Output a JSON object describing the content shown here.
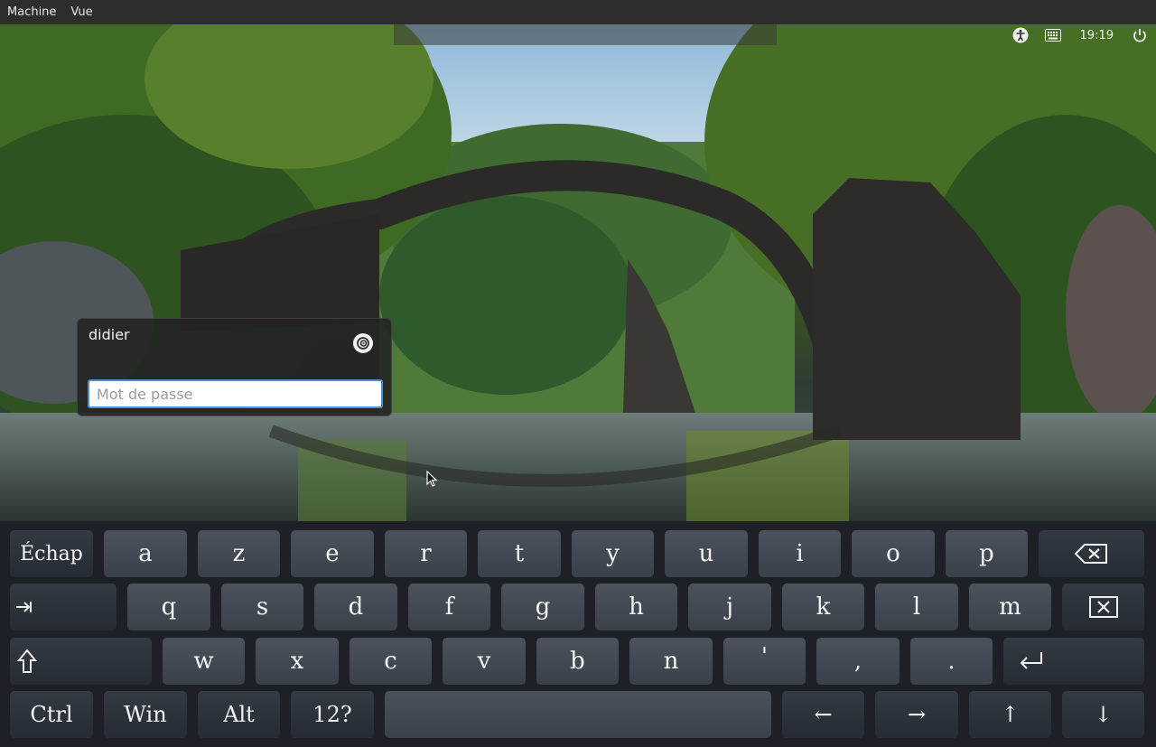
{
  "vm_menu": {
    "machine": "Machine",
    "view": "Vue"
  },
  "panel": {
    "clock": "19:19",
    "icons": [
      "accessibility-icon",
      "keyboard-icon",
      "power-icon"
    ]
  },
  "login": {
    "username": "didier",
    "password_placeholder": "Mot de passe",
    "password_value": ""
  },
  "keyboard": {
    "row1": {
      "esc": "Échap",
      "letters": [
        "a",
        "z",
        "e",
        "r",
        "t",
        "y",
        "u",
        "i",
        "o",
        "p"
      ]
    },
    "row2": {
      "letters": [
        "q",
        "s",
        "d",
        "f",
        "g",
        "h",
        "j",
        "k",
        "l",
        "m"
      ]
    },
    "row3": {
      "letters": [
        "w",
        "x",
        "c",
        "v",
        "b",
        "n",
        "'",
        ",",
        "."
      ]
    },
    "row4": {
      "ctrl": "Ctrl",
      "win": "Win",
      "alt": "Alt",
      "num": "12?",
      "left": "←",
      "right": "→",
      "up": "↑",
      "down": "↓"
    }
  },
  "colors": {
    "focus_border": "#4a90d9",
    "key_bg": "#434952",
    "mod_key_bg": "#2d3239"
  }
}
